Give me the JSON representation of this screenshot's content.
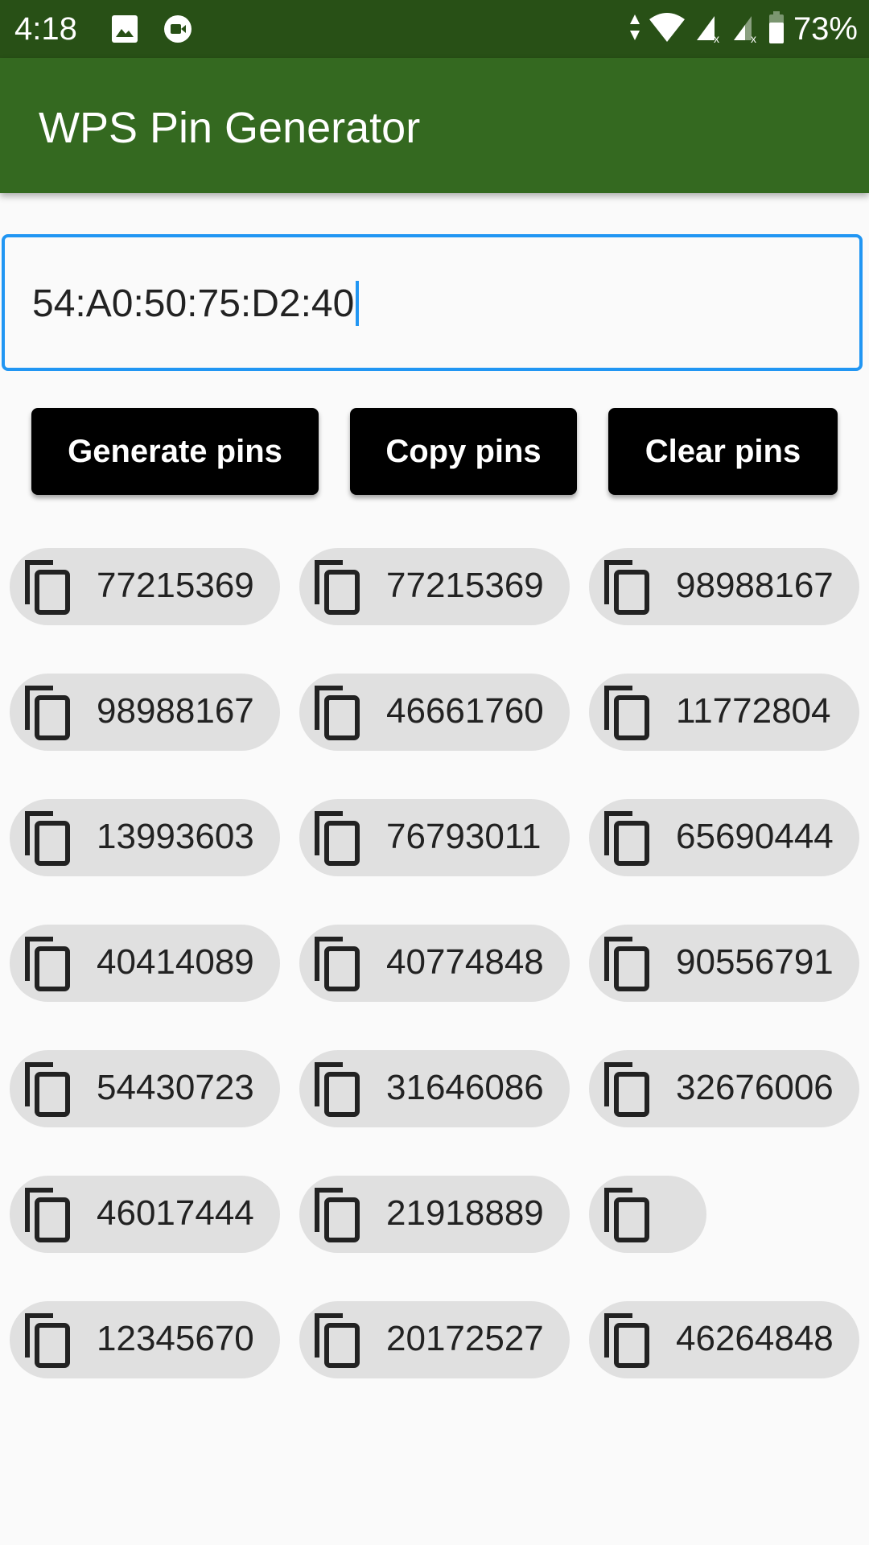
{
  "status_bar": {
    "time": "4:18",
    "left_icons": [
      "image-icon",
      "video-call-icon"
    ],
    "right_icons": [
      "data-arrows-icon",
      "wifi-icon",
      "signal-no-sim-icon",
      "signal-no-sim-icon",
      "battery-icon"
    ],
    "battery_percent": "73%"
  },
  "app_bar": {
    "title": "WPS Pin Generator",
    "color": "#346920"
  },
  "mac_input": {
    "value": "54:A0:50:75:D2:40",
    "focus_color": "#2196f3"
  },
  "buttons": {
    "generate_label": "Generate pins",
    "copy_label": "Copy pins",
    "clear_label": "Clear pins"
  },
  "pins": [
    [
      "77215369",
      "77215369",
      "98988167"
    ],
    [
      "98988167",
      "46661760",
      "11772804"
    ],
    [
      "13993603",
      "76793011",
      "65690444"
    ],
    [
      "40414089",
      "40774848",
      "90556791"
    ],
    [
      "54430723",
      "31646086",
      "32676006"
    ],
    [
      "46017444",
      "21918889",
      ""
    ],
    [
      "12345670",
      "20172527",
      "46264848"
    ]
  ],
  "chip_icon": "copy-icon"
}
